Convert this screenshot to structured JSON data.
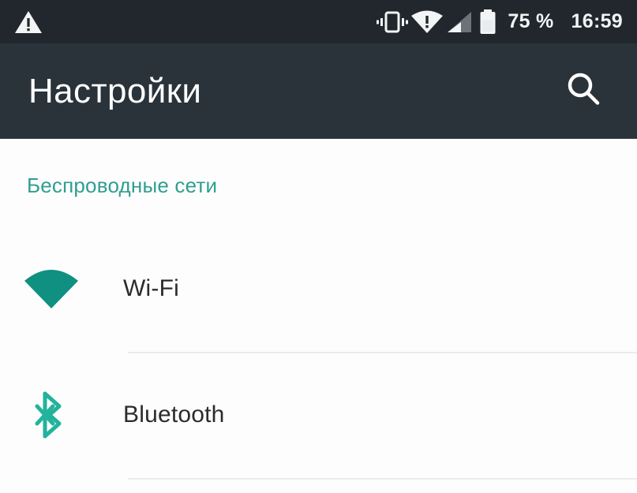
{
  "status_bar": {
    "background_color": "#22272d",
    "left_icons": [
      {
        "name": "warning-triangle-icon",
        "label": "warning-triangle-icon"
      }
    ],
    "right_icons": [
      {
        "name": "vibrate-icon",
        "label": "vibrate-icon"
      },
      {
        "name": "wifi-alert-icon",
        "label": "wifi-alert-icon"
      },
      {
        "name": "cellular-signal-icon",
        "label": "cellular-signal-icon"
      },
      {
        "name": "battery-icon",
        "label": "battery-icon"
      }
    ],
    "battery_percent": "75 %",
    "clock": "16:59"
  },
  "app_bar": {
    "background_color": "#2b333a",
    "title": "Настройки",
    "search_icon": "search-icon"
  },
  "content": {
    "background_color": "#fdfdfd",
    "accent_color": "#0f9080",
    "header_color": "#2f9e90",
    "sections": [
      {
        "header": "Беспроводные сети",
        "rows": [
          {
            "label": "Wi-Fi",
            "icon": "wifi-icon"
          },
          {
            "label": "Bluetooth",
            "icon": "bluetooth-icon"
          }
        ]
      }
    ]
  }
}
